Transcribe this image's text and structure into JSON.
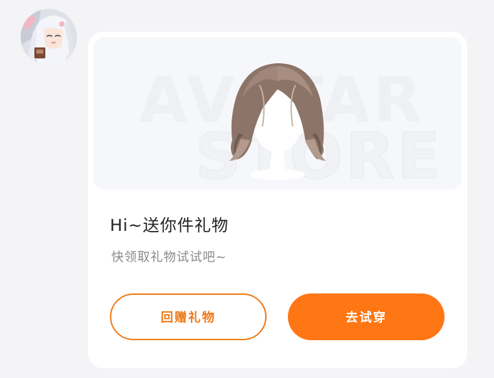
{
  "colors": {
    "accent": "#ff7614",
    "outline": "#f07a18",
    "page_bg": "#f4f4f6",
    "card_bg": "#ffffff"
  },
  "banner": {
    "watermark_line1": "AVATAR",
    "watermark_line2": "STORE"
  },
  "gift": {
    "title": "Hi~送你件礼物",
    "subtitle": "快领取礼物试试吧~"
  },
  "actions": {
    "return_gift": "回赠礼物",
    "try_on": "去试穿"
  }
}
